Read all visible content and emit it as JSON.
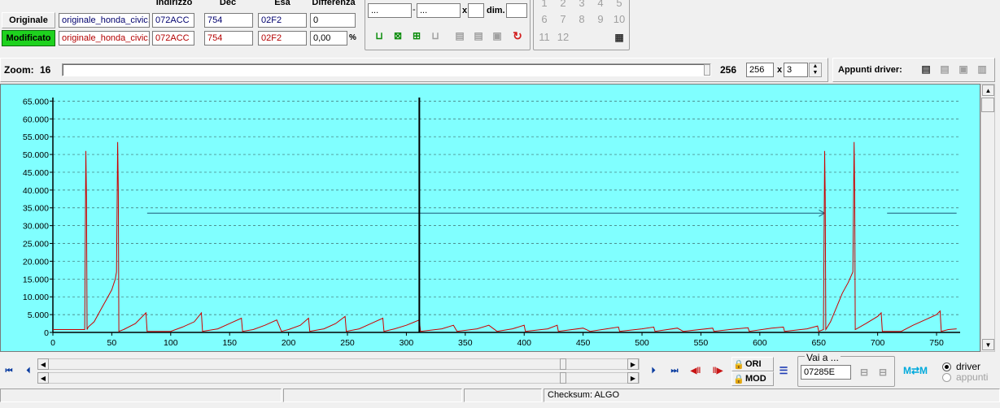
{
  "header": {
    "col_indirizzo": "Indirizzo",
    "col_dec": "Dec",
    "col_esa": "Esa",
    "col_differenza": "Differenza"
  },
  "originale": {
    "label": "Originale",
    "file": "originale_honda_civic.",
    "indirizzo": "072ACC",
    "dec": "754",
    "esa": "02F2",
    "differenza": "0"
  },
  "modificato": {
    "label": "Modificato",
    "file": "originale_honda_civic.",
    "indirizzo": "072ACC",
    "dec": "754",
    "esa": "02F2",
    "differenza": "0,00",
    "percent": "%"
  },
  "range": {
    "from": "...",
    "to": "...",
    "sep": "-",
    "x_label": "x",
    "dim_label": "dim."
  },
  "keypad": [
    "1",
    "2",
    "3",
    "4",
    "5",
    "6",
    "7",
    "8",
    "9",
    "10",
    "11",
    "12"
  ],
  "zoom": {
    "label": "Zoom:",
    "value": "16",
    "max_label": "256",
    "field_value": "256",
    "x_label": "x",
    "mult_value": "3"
  },
  "appunti": {
    "label": "Appunti driver:"
  },
  "chart_data": {
    "type": "line",
    "background": "#80ffff",
    "line_color": "#cc0000",
    "grid": true,
    "xlim": [
      0,
      770
    ],
    "ylim": [
      0,
      66000
    ],
    "xticks": [
      "0",
      "50",
      "100",
      "150",
      "200",
      "250",
      "300",
      "350",
      "400",
      "450",
      "500",
      "550",
      "600",
      "650",
      "700",
      "750"
    ],
    "yticks": [
      "0",
      "5.000",
      "10.000",
      "15.000",
      "20.000",
      "25.000",
      "30.000",
      "35.000",
      "40.000",
      "45.000",
      "50.000",
      "55.000",
      "60.000",
      "65.000"
    ],
    "cursor_x": 311,
    "series": [
      {
        "values": [
          [
            0,
            800
          ],
          [
            27,
            800
          ],
          [
            28,
            51000
          ],
          [
            28.5,
            38000
          ],
          [
            29,
            800
          ],
          [
            30,
            1500
          ],
          [
            35,
            3000
          ],
          [
            40,
            6000
          ],
          [
            45,
            9000
          ],
          [
            50,
            12000
          ],
          [
            53,
            15000
          ],
          [
            54,
            17000
          ],
          [
            55,
            53500
          ],
          [
            55.5,
            40000
          ],
          [
            56,
            300
          ],
          [
            60,
            800
          ],
          [
            70,
            2500
          ],
          [
            79,
            5500
          ],
          [
            80,
            300
          ],
          [
            100,
            300
          ],
          [
            110,
            1500
          ],
          [
            120,
            3000
          ],
          [
            126,
            5500
          ],
          [
            127,
            300
          ],
          [
            140,
            1000
          ],
          [
            150,
            2500
          ],
          [
            160,
            4000
          ],
          [
            161,
            300
          ],
          [
            170,
            800
          ],
          [
            180,
            2000
          ],
          [
            190,
            3500
          ],
          [
            194,
            300
          ],
          [
            200,
            800
          ],
          [
            210,
            2000
          ],
          [
            217,
            4000
          ],
          [
            218,
            300
          ],
          [
            230,
            1000
          ],
          [
            240,
            2500
          ],
          [
            248,
            4500
          ],
          [
            249,
            300
          ],
          [
            260,
            1000
          ],
          [
            270,
            2500
          ],
          [
            280,
            4000
          ],
          [
            281,
            300
          ],
          [
            290,
            1000
          ],
          [
            300,
            2000
          ],
          [
            311,
            3500
          ],
          [
            312,
            300
          ],
          [
            330,
            1000
          ],
          [
            340,
            2000
          ],
          [
            343,
            300
          ],
          [
            360,
            1000
          ],
          [
            370,
            2000
          ],
          [
            377,
            300
          ],
          [
            390,
            1000
          ],
          [
            400,
            2000
          ],
          [
            401,
            300
          ],
          [
            420,
            1000
          ],
          [
            428,
            2000
          ],
          [
            429,
            300
          ],
          [
            450,
            1200
          ],
          [
            456,
            300
          ],
          [
            470,
            1000
          ],
          [
            480,
            1500
          ],
          [
            481,
            300
          ],
          [
            500,
            1000
          ],
          [
            510,
            1500
          ],
          [
            511,
            300
          ],
          [
            530,
            1200
          ],
          [
            535,
            300
          ],
          [
            560,
            1200
          ],
          [
            561,
            300
          ],
          [
            580,
            1000
          ],
          [
            590,
            1300
          ],
          [
            591,
            300
          ],
          [
            610,
            1200
          ],
          [
            620,
            1500
          ],
          [
            621,
            300
          ],
          [
            640,
            1000
          ],
          [
            649,
            1800
          ],
          [
            650,
            300
          ],
          [
            654,
            800
          ],
          [
            655,
            51000
          ],
          [
            655.5,
            38000
          ],
          [
            656,
            800
          ],
          [
            660,
            3000
          ],
          [
            665,
            7000
          ],
          [
            670,
            11000
          ],
          [
            675,
            14000
          ],
          [
            679,
            17000
          ],
          [
            680,
            53500
          ],
          [
            680.5,
            40000
          ],
          [
            681,
            800
          ],
          [
            690,
            2500
          ],
          [
            700,
            4500
          ],
          [
            703,
            5500
          ],
          [
            704,
            300
          ],
          [
            720,
            300
          ],
          [
            730,
            2000
          ],
          [
            740,
            3500
          ],
          [
            750,
            5000
          ],
          [
            753,
            6000
          ],
          [
            754,
            300
          ],
          [
            760,
            800
          ],
          [
            767,
            1000
          ]
        ]
      }
    ],
    "arrow_y": 33500
  },
  "nav": {
    "ori_label": "ORI",
    "mod_label": "MOD",
    "vai_label": "Vai a ...",
    "vai_value": "07285E",
    "radio_driver": "driver",
    "radio_appunti": "appunti"
  },
  "status": {
    "checksum": "Checksum: ALGO"
  }
}
